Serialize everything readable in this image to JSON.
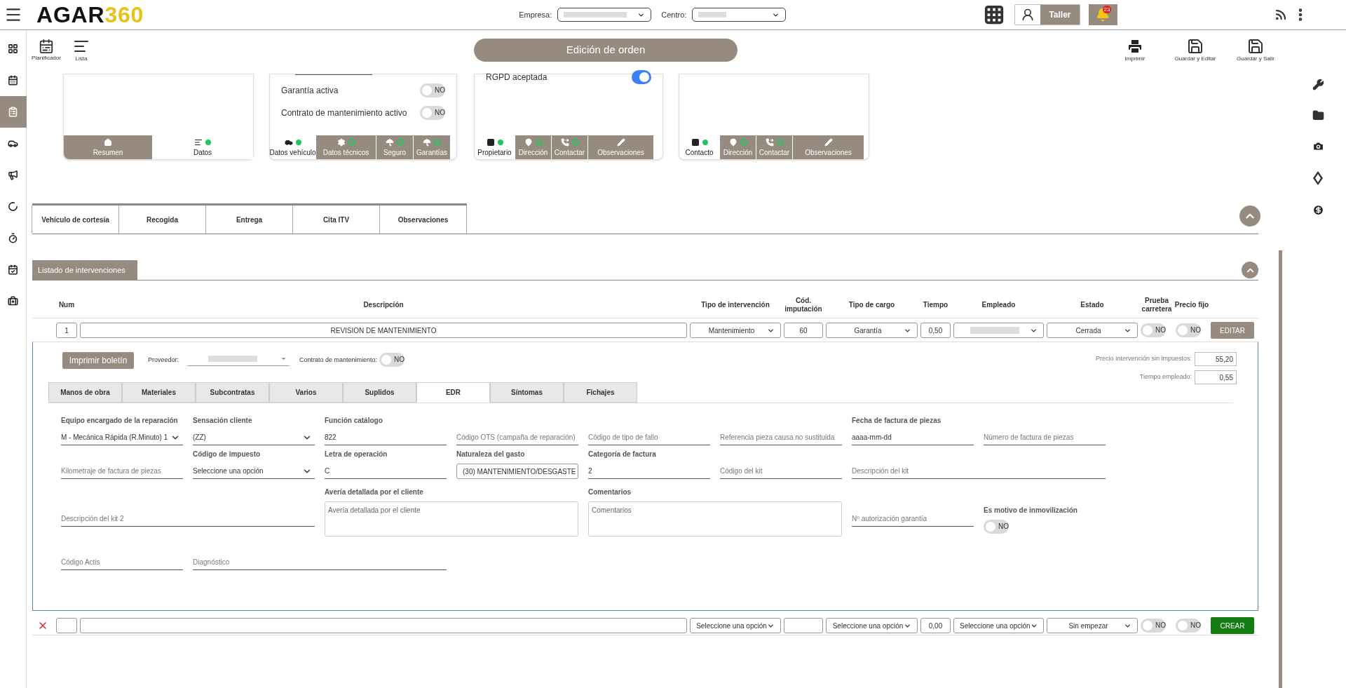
{
  "header": {
    "logo_main": "AGAR",
    "logo_accent": "360",
    "empresa_label": "Empresa:",
    "centro_label": "Centro:",
    "workshop_button": "Taller",
    "notifications": "23"
  },
  "sidebar": {
    "items": [
      {
        "selected": false
      },
      {
        "selected": false
      },
      {
        "selected": true
      },
      {
        "selected": false
      },
      {
        "selected": false
      },
      {
        "selected": false
      },
      {
        "selected": false
      },
      {
        "selected": false
      },
      {
        "selected": false
      }
    ]
  },
  "toolbar": {
    "left": [
      "Planificador",
      "Lista"
    ],
    "title": "Edición de orden",
    "right": [
      "Imprimir",
      "Guardar y Editar",
      "Guardar y Salir"
    ]
  },
  "cards": [
    {
      "tabs": [
        {
          "label": "Resumen",
          "dot": false,
          "selected": false
        },
        {
          "label": "Datos",
          "dot": true,
          "complete": true,
          "selected": true
        }
      ]
    },
    {
      "rows": [
        {
          "label": "Garantía activa",
          "on": false,
          "text": "NO"
        },
        {
          "label": "Contrato de mantenimiento activo",
          "on": false,
          "text": "NO"
        }
      ],
      "tabs": [
        {
          "label": "Datos vehículo",
          "dot": true,
          "complete": true,
          "selected": true
        },
        {
          "label": "Datos técnicos",
          "dot": true,
          "complete": false,
          "selected": false
        },
        {
          "label": "Seguro",
          "dot": true,
          "complete": false,
          "selected": false
        },
        {
          "label": "Garantías",
          "dot": true,
          "complete": false,
          "selected": false
        }
      ]
    },
    {
      "rows": [
        {
          "label": "RGPD aceptada",
          "on": true
        }
      ],
      "tabs": [
        {
          "label": "Propietario",
          "dot": true,
          "complete": true,
          "selected": true
        },
        {
          "label": "Dirección",
          "dot": true,
          "complete": false,
          "selected": false
        },
        {
          "label": "Contactar",
          "dot": true,
          "complete": false,
          "selected": false
        },
        {
          "label": "Observaciones",
          "dot": false,
          "selected": false
        }
      ]
    },
    {
      "tabs": [
        {
          "label": "Contacto",
          "dot": true,
          "complete": true,
          "selected": true
        },
        {
          "label": "Dirección",
          "dot": true,
          "complete": false,
          "selected": false
        },
        {
          "label": "Contactar",
          "dot": true,
          "complete": false,
          "selected": false
        },
        {
          "label": "Observaciones",
          "dot": false,
          "selected": false
        }
      ]
    }
  ],
  "section_tabs": [
    "Vehículo de cortesía",
    "Recogida",
    "Entrega",
    "Cita ITV",
    "Observaciones"
  ],
  "interventions": {
    "title": "Listado de intervenciones",
    "columns": [
      "Num",
      "Descripción",
      "Tipo de intervención",
      "Cód. imputación",
      "Tipo de cargo",
      "Tiempo",
      "Empleado",
      "Estado",
      "Prueba carretera",
      "Precio fijo"
    ],
    "row": {
      "num": "1",
      "description": "REVISION DE MANTENIMIENTO",
      "type": "Mantenimiento",
      "code": "60",
      "charge": "Garantía",
      "time": "0,50",
      "status": "Cerrada",
      "road_test": {
        "on": false,
        "text": "NO"
      },
      "fixed_price": {
        "on": false,
        "text": "NO"
      },
      "action": "EDITAR"
    },
    "new_row": {
      "type": "Seleccione una opción",
      "charge": "Seleccione una opción",
      "time": "0,00",
      "employee": "Seleccione una opción",
      "status": "Sin empezar",
      "road_test": {
        "on": false,
        "text": "NO"
      },
      "fixed_price": {
        "on": false,
        "text": "NO"
      },
      "action": "CREAR"
    }
  },
  "detail": {
    "print_button": "Imprimir boletín",
    "provider_label": "Proveedor:",
    "contract_label": "Contrato de mantenimiento:",
    "contract_toggle": {
      "on": false,
      "text": "NO"
    },
    "price_label": "Precio Intervención sin impuestos:",
    "price": "55,20",
    "time_label": "Tiempo empleado:",
    "time": "0,55",
    "tabs": [
      {
        "label": "Manos de obra",
        "selected": false
      },
      {
        "label": "Materiales",
        "selected": false
      },
      {
        "label": "Subcontratas",
        "selected": false
      },
      {
        "label": "Varios",
        "selected": false
      },
      {
        "label": "Suplidos",
        "selected": false
      },
      {
        "label": "EDR",
        "selected": true
      },
      {
        "label": "Síntomas",
        "selected": false
      },
      {
        "label": "Fichajes",
        "selected": false
      }
    ],
    "fields": [
      {
        "kind": "select",
        "label": "Equipo encargado de la reparación",
        "value": "M - Mecánica Rápida (R.Minuto) 1"
      },
      {
        "kind": "select",
        "label": "Sensación cliente",
        "value": "(ZZ)"
      },
      {
        "kind": "input",
        "label": "Función catálogo",
        "value": "822"
      },
      {
        "kind": "input",
        "placeholder": "Código OTS (campaña de reparación)"
      },
      {
        "kind": "input",
        "placeholder": "Código de tipo de fallo"
      },
      {
        "kind": "input",
        "placeholder": "Referencia pieza causa no sustituida"
      },
      {
        "kind": "input",
        "label": "Fecha de factura de piezas",
        "value": "aaaa-mm-dd"
      },
      {
        "kind": "input",
        "placeholder": "Número de factura de piezas"
      },
      {
        "kind": "input",
        "placeholder": "Kilometraje de factura de piezas"
      },
      {
        "kind": "select",
        "label": "Código de impuesto",
        "value": "Seleccione una opción"
      },
      {
        "kind": "input",
        "label": "Letra de operación",
        "value": "C"
      },
      {
        "kind": "boxed_select",
        "label": "Naturaleza del gasto",
        "value": "(30) MANTENIMIENTO/DESGASTE"
      },
      {
        "kind": "input",
        "label": "Categoría de factura",
        "value": "2"
      },
      {
        "kind": "input",
        "placeholder": "Código del kit"
      },
      {
        "kind": "input",
        "placeholder": "Descripción del kit"
      },
      {
        "kind": "input",
        "placeholder": "Descripción del kit 2"
      },
      {
        "kind": "textarea",
        "label": "Avería detallada por el cliente",
        "placeholder": "Avería detallada por el cliente"
      },
      {
        "kind": "textarea",
        "label": "Comentarios",
        "placeholder": "Comentarios"
      },
      {
        "kind": "input",
        "placeholder": "Nº autorización garantía"
      },
      {
        "kind": "toggle",
        "label": "Es motivo de inmovilización",
        "on": false,
        "text": "NO"
      },
      {
        "kind": "input",
        "placeholder": "Código Actis"
      },
      {
        "kind": "input",
        "placeholder": "Diagnóstico"
      }
    ]
  }
}
